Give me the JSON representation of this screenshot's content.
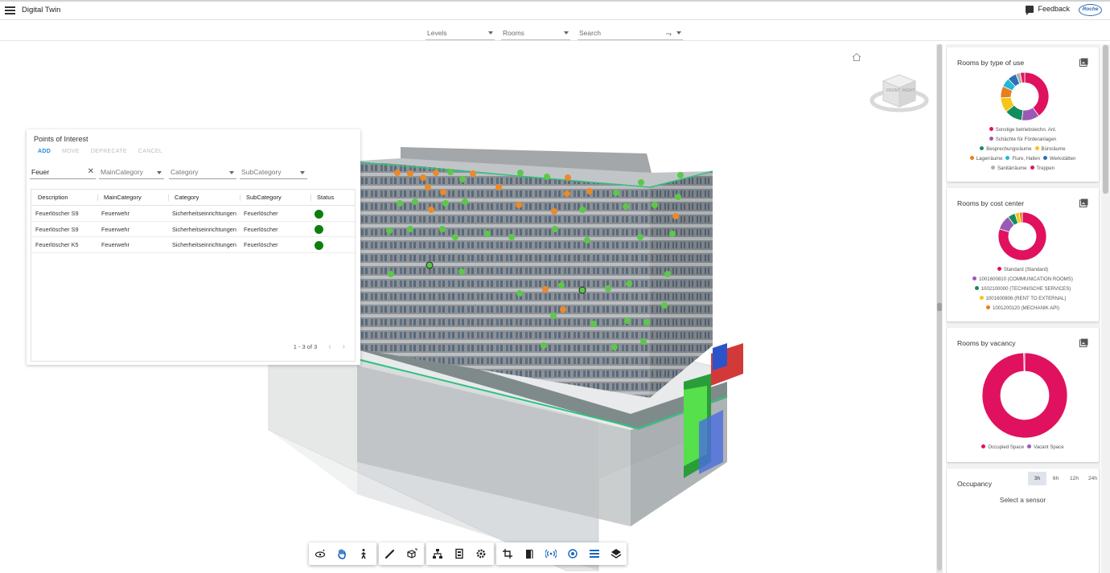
{
  "app": {
    "title": "Digital Twin",
    "feedback_label": "Feedback",
    "logo_text": "Roche"
  },
  "filters": {
    "levels": "Levels",
    "rooms": "Rooms",
    "search_placeholder": "Search"
  },
  "poi": {
    "title": "Points of Interest",
    "actions": {
      "add": "ADD",
      "move": "MOVE",
      "deprecate": "DEPRECATE",
      "cancel": "CANCEL"
    },
    "search_value": "Feuer",
    "main_category": "MainCategory",
    "category": "Category",
    "sub_category": "SubCategory",
    "columns": [
      "Description",
      "MainCategory",
      "Category",
      "SubCategory",
      "Status"
    ],
    "rows": [
      {
        "description": "Feuerlöscher S9",
        "main": "Feuerwehr",
        "category": "Sicherheitseinrichtungen",
        "sub": "Feuerlöscher",
        "status": "green"
      },
      {
        "description": "Feuerlöscher S9",
        "main": "Feuerwehr",
        "category": "Sicherheitseinrichtungen",
        "sub": "Feuerlöscher",
        "status": "green"
      },
      {
        "description": "Feuerlöscher K5",
        "main": "Feuerwehr",
        "category": "Sicherheitseinrichtungen",
        "sub": "Feuerlöscher",
        "status": "green"
      }
    ],
    "pagination": "1 - 3 of 3"
  },
  "toolbar": {
    "groups": [
      [
        "orbit-icon",
        "pan-icon",
        "walk-icon"
      ],
      [
        "measure-icon",
        "explode-icon"
      ],
      [
        "model-browser-icon",
        "properties-icon",
        "settings-icon"
      ],
      [
        "section-icon",
        "door-icon",
        "sensor-icon",
        "poi-icon",
        "levels-list-icon",
        "layers-icon"
      ]
    ]
  },
  "cards": {
    "type_of_use": {
      "title": "Rooms by type of use",
      "legend": [
        {
          "label": "Sonstige betriebstechn. Anl.",
          "color": "#e0115f"
        },
        {
          "label": "Schächte für Förderanlagen",
          "color": "#9b59b6"
        },
        {
          "label": "Besprechungsräume",
          "color": "#138d5e"
        },
        {
          "label": "Büroräume",
          "color": "#f5c518"
        },
        {
          "label": "Lagerräume",
          "color": "#e67e22"
        },
        {
          "label": "Flure, Hallen",
          "color": "#1fb8d6"
        },
        {
          "label": "Werkstätten",
          "color": "#2f6fb5"
        },
        {
          "label": "Sanitärräume",
          "color": "#b0b0b0"
        },
        {
          "label": "Treppen",
          "color": "#d81b60"
        }
      ],
      "slices": [
        {
          "value": 40,
          "color": "#e0115f"
        },
        {
          "value": 12,
          "color": "#9b59b6"
        },
        {
          "value": 12,
          "color": "#138d5e"
        },
        {
          "value": 10,
          "color": "#f5c518"
        },
        {
          "value": 8,
          "color": "#e67e22"
        },
        {
          "value": 6,
          "color": "#1fb8d6"
        },
        {
          "value": 6,
          "color": "#2f6fb5"
        },
        {
          "value": 3,
          "color": "#b0b0b0"
        },
        {
          "value": 3,
          "color": "#d81b60"
        }
      ]
    },
    "cost_center": {
      "title": "Rooms by cost center",
      "legend": [
        {
          "label": "Standard (Standard)",
          "color": "#e0115f"
        },
        {
          "label": "1001600810 (COMMUNICATION ROOMS)",
          "color": "#9b59b6"
        },
        {
          "label": "1002100000 (TECHNISCHE SERVICES)",
          "color": "#138d5e"
        },
        {
          "label": "1001600806 (RENT TO EXTERNAL)",
          "color": "#f5c518"
        },
        {
          "label": "1001200120 (MECHANIK API)",
          "color": "#e67e22"
        }
      ],
      "slices": [
        {
          "value": 80,
          "color": "#e0115f"
        },
        {
          "value": 10,
          "color": "#9b59b6"
        },
        {
          "value": 5,
          "color": "#138d5e"
        },
        {
          "value": 3,
          "color": "#f5c518"
        },
        {
          "value": 2,
          "color": "#e67e22"
        }
      ]
    },
    "vacancy": {
      "title": "Rooms by vacancy",
      "legend": [
        {
          "label": "Occupied Space",
          "color": "#e0115f"
        },
        {
          "label": "Vacant Space",
          "color": "#9b59b6"
        }
      ],
      "slices": [
        {
          "value": 99.6,
          "color": "#e0115f"
        },
        {
          "value": 0.4,
          "color": "#9b59b6"
        }
      ]
    },
    "occupancy": {
      "title": "Occupancy",
      "tabs": [
        "3h",
        "6h",
        "12h",
        "24h"
      ],
      "active_tab": "3h",
      "message": "Select a sensor"
    }
  }
}
